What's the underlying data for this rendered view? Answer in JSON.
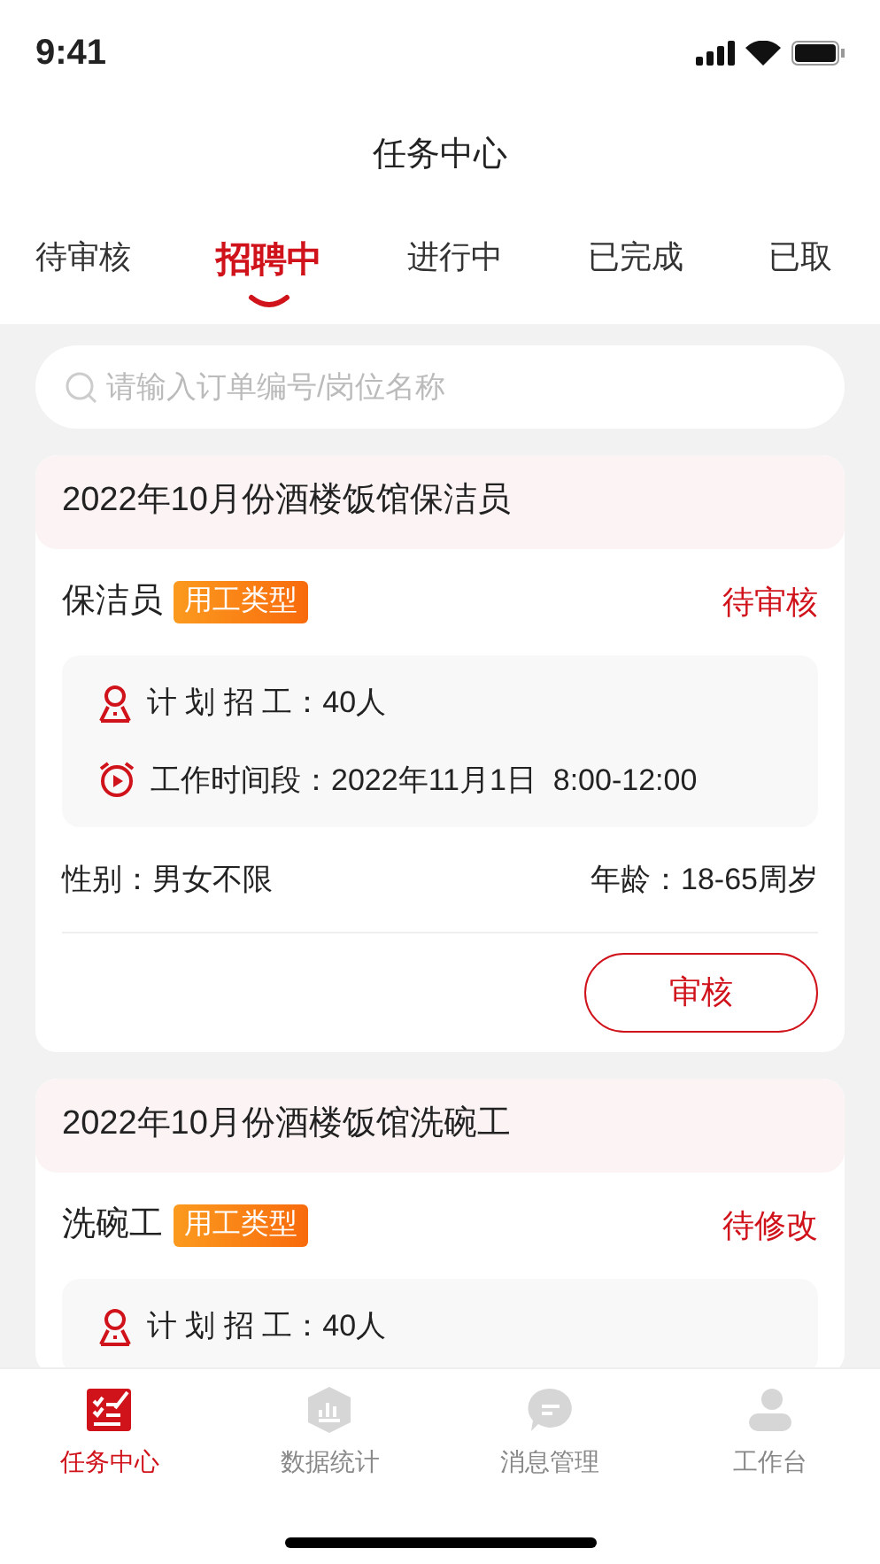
{
  "status_bar": {
    "time": "9:41"
  },
  "title": "任务中心",
  "tabs": [
    {
      "label": "待审核",
      "selected": false
    },
    {
      "label": "招聘中",
      "selected": true
    },
    {
      "label": "进行中",
      "selected": false
    },
    {
      "label": "已完成",
      "selected": false
    },
    {
      "label": "已取",
      "selected": false
    }
  ],
  "search": {
    "placeholder": "请输入订单编号/岗位名称"
  },
  "orders": [
    {
      "title": "2022年10月份酒楼饭馆保洁员",
      "position": "保洁员",
      "tag": "用工类型",
      "status": "待审核",
      "details": [
        {
          "kind": "people",
          "text": "计 划 招 工：40人"
        },
        {
          "kind": "time",
          "text": "工作时间段：2022年11月1日  8:00-12:00"
        }
      ],
      "gender": "性别：男女不限",
      "age": "年龄：18-65周岁",
      "action": "审核"
    },
    {
      "title": "2022年10月份酒楼饭馆洗碗工",
      "position": "洗碗工",
      "tag": "用工类型",
      "status": "待修改",
      "details": [
        {
          "kind": "people",
          "text": "计 划 招 工：40人"
        }
      ]
    }
  ],
  "nav": [
    {
      "label": "任务中心",
      "kind": "tasks",
      "selected": true
    },
    {
      "label": "数据统计",
      "kind": "stats",
      "selected": false
    },
    {
      "label": "消息管理",
      "kind": "messages",
      "selected": false
    },
    {
      "label": "工作台",
      "kind": "workbench",
      "selected": false
    }
  ]
}
